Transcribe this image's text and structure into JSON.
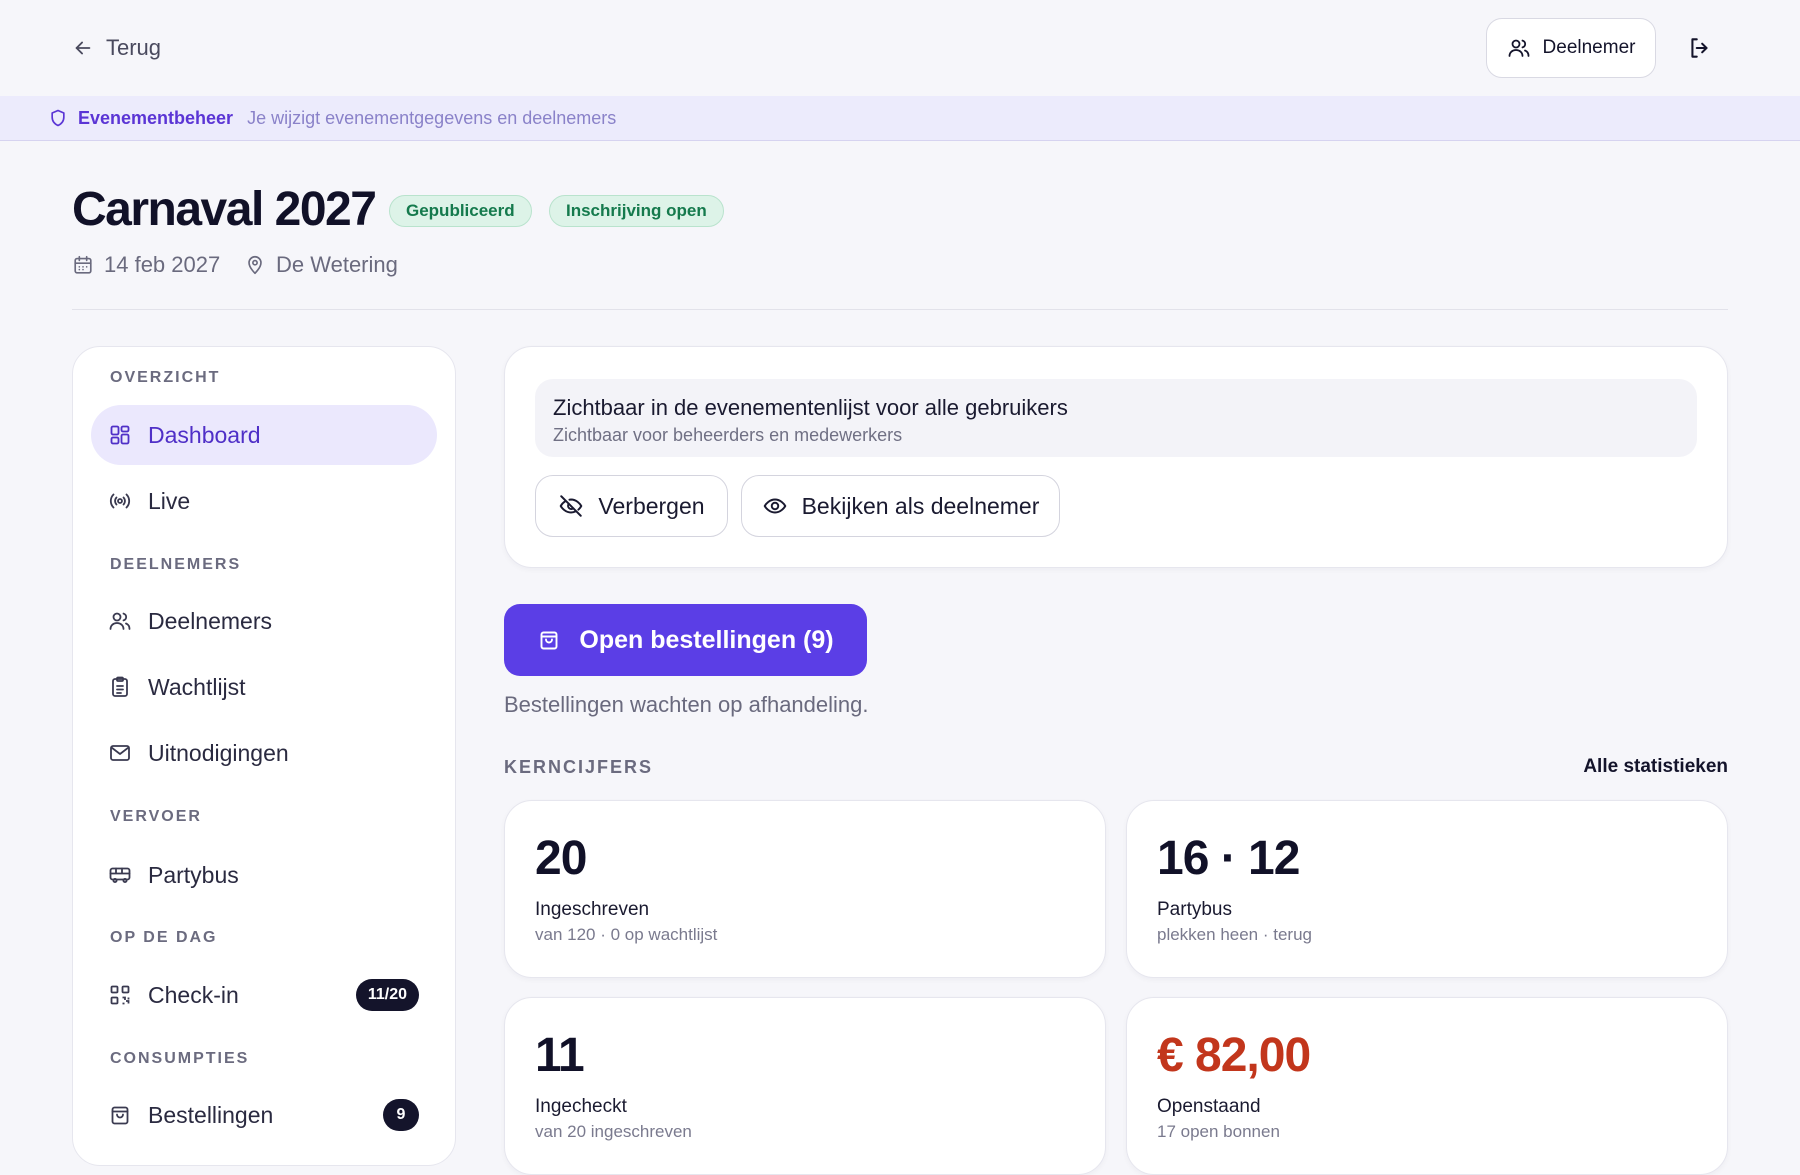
{
  "topbar": {
    "back_label": "Terug",
    "role_label": "Deelnemer"
  },
  "banner": {
    "title": "Evenementbeheer",
    "subtitle": "Je wijzigt evenementgegevens en deelnemers"
  },
  "event": {
    "title": "Carnaval 2027",
    "badges": [
      "Gepubliceerd",
      "Inschrijving open"
    ],
    "date": "14 feb 2027",
    "location": "De Wetering"
  },
  "sidebar": {
    "sections": [
      {
        "label": "OVERZICHT"
      },
      {
        "label": "DEELNEMERS"
      },
      {
        "label": "VERVOER"
      },
      {
        "label": "OP DE DAG"
      },
      {
        "label": "CONSUMPTIES"
      }
    ],
    "items": [
      {
        "label": "Dashboard",
        "icon": "dashboard-icon",
        "active": true
      },
      {
        "label": "Live",
        "icon": "broadcast-icon"
      },
      {
        "label": "Deelnemers",
        "icon": "users-icon"
      },
      {
        "label": "Wachtlijst",
        "icon": "clipboard-icon"
      },
      {
        "label": "Uitnodigingen",
        "icon": "mail-icon"
      },
      {
        "label": "Partybus",
        "icon": "bus-icon"
      },
      {
        "label": "Check-in",
        "icon": "qr-code-icon",
        "count": "11/20"
      },
      {
        "label": "Bestellingen",
        "icon": "shopping-bag-icon",
        "count": "9"
      }
    ]
  },
  "visibility": {
    "title": "Zichtbaar in de evenementenlijst voor alle gebruikers",
    "subtitle": "Zichtbaar voor beheerders en medewerkers",
    "hide_label": "Verbergen",
    "view_as_label": "Bekijken als deelnemer"
  },
  "orders": {
    "button_label": "Open bestellingen (9)",
    "subtitle": "Bestellingen wachten op afhandeling."
  },
  "kpis": {
    "label": "KERNCIJFERS",
    "all_stats_label": "Alle statistieken",
    "cards": [
      {
        "value": "20",
        "title": "Ingeschreven",
        "sub": "van 120 · 0 op wachtlijst"
      },
      {
        "value": "16 · 12",
        "title": "Partybus",
        "sub": "plekken heen · terug"
      },
      {
        "value": "11",
        "title": "Ingecheckt",
        "sub": "van 20 ingeschreven"
      },
      {
        "value": "€ 82,00",
        "title": "Openstaand",
        "sub": "17 open bonnen"
      }
    ]
  },
  "colors": {
    "accent": "#5b3ee6",
    "badge_green": "#157a4d",
    "amount_red": "#c2361c"
  }
}
